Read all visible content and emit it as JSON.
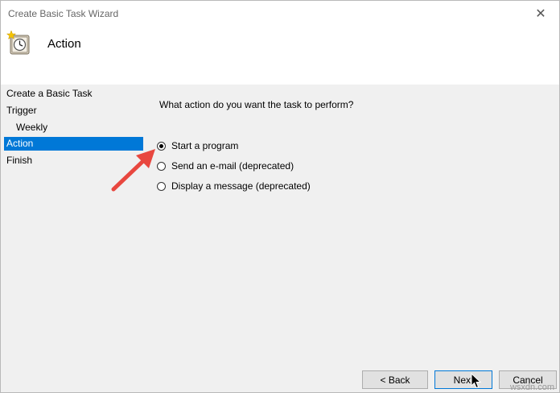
{
  "window": {
    "title": "Create Basic Task Wizard",
    "close_glyph": "✕"
  },
  "header": {
    "title": "Action",
    "icon": "task-scheduler-clock-icon"
  },
  "sidebar": {
    "items": [
      {
        "label": "Create a Basic Task",
        "active": false
      },
      {
        "label": "Trigger",
        "active": false
      },
      {
        "label": "Weekly",
        "active": false
      },
      {
        "label": "Action",
        "active": true
      },
      {
        "label": "Finish",
        "active": false
      }
    ]
  },
  "main": {
    "question": "What action do you want the task to perform?",
    "options": [
      {
        "label": "Start a program",
        "checked": true
      },
      {
        "label": "Send an e-mail (deprecated)",
        "checked": false
      },
      {
        "label": "Display a message (deprecated)",
        "checked": false
      }
    ],
    "annotation_arrow_color": "#e8473f"
  },
  "footer": {
    "back_label": "< Back",
    "next_label": "Next",
    "cancel_label": "Cancel"
  },
  "watermark": "wsxdn.com",
  "colors": {
    "accent": "#0078d7",
    "panel": "#f0f0f0"
  }
}
